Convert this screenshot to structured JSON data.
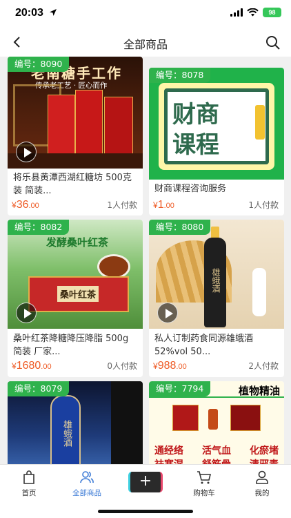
{
  "status": {
    "time": "20:03",
    "battery": "98"
  },
  "nav": {
    "title": "全部商品"
  },
  "products": [
    {
      "badge": "编号：8090",
      "title": "将乐县黄潭西湖红糖坊 500克装 简装...",
      "price_cur": "¥",
      "price_int": "36",
      "price_dec": ".00",
      "buyers": "1人付款",
      "image_text": {
        "top": "老南糖手工作",
        "sub": "传承老工艺 · 匠心而作"
      },
      "has_video": true
    },
    {
      "badge": "编号：8078",
      "title": "财商课程咨询服务",
      "price_cur": "¥",
      "price_int": "1",
      "price_dec": ".00",
      "buyers": "1人付款",
      "image_text": {
        "line1": "财商",
        "line2": "课程"
      },
      "has_video": false
    },
    {
      "badge": "编号：8082",
      "title": "桑叶红茶降糖降压降脂 500g简装 厂家...",
      "price_cur": "¥",
      "price_int": "1680",
      "price_dec": ".00",
      "buyers": "0人付款",
      "image_text": {
        "top": "发酵桑叶红茶",
        "box": "桑叶红茶"
      },
      "has_video": true
    },
    {
      "badge": "编号：8080",
      "title": "私人订制药食同源雄蛾酒 52%vol 50...",
      "price_cur": "¥",
      "price_int": "988",
      "price_dec": ".00",
      "buyers": "2人付款",
      "image_text": {
        "label": "雄蛾酒"
      },
      "has_video": true
    },
    {
      "badge": "编号：8079",
      "image_text": {
        "label": "雄蛾酒"
      }
    },
    {
      "badge": "编号：7794",
      "image_text": {
        "header": "植物精油",
        "row1": [
          "通经络",
          "活气血",
          "化瘀堵"
        ],
        "row2": [
          "祛寒湿",
          "舒筋骨",
          "清邪毒"
        ]
      }
    }
  ],
  "tabs": [
    {
      "label": "首页",
      "icon": "bag-icon"
    },
    {
      "label": "全部商品",
      "icon": "users-icon"
    },
    {
      "label": "",
      "icon": "plus-icon"
    },
    {
      "label": "购物车",
      "icon": "cart-icon"
    },
    {
      "label": "我的",
      "icon": "person-icon"
    }
  ],
  "colors": {
    "accent": "#2fb24c",
    "price": "#ee5a24",
    "active_tab": "#3d7bd6"
  }
}
